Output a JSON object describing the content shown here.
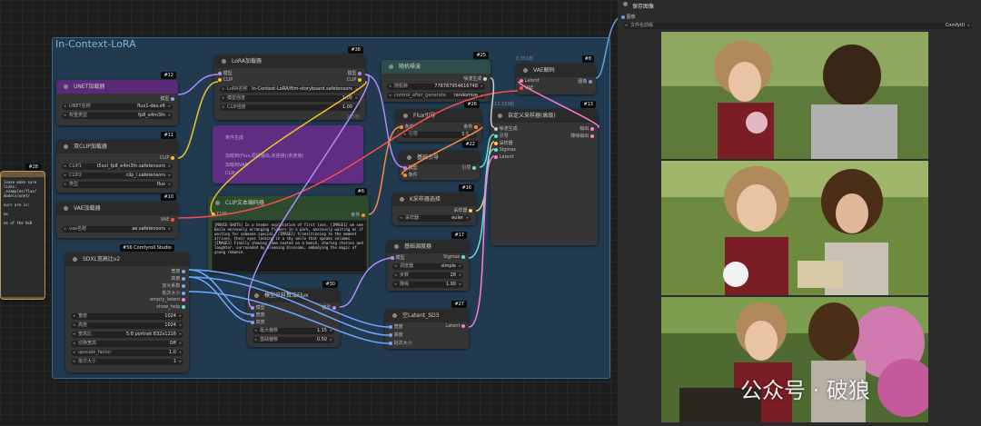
{
  "group": {
    "title": "In-Context-LoRA"
  },
  "nodes": {
    "unet": {
      "title": "UNET加载器",
      "badge": "#12",
      "out": "模型",
      "w1_l": "UNET名称",
      "w1_v": "flux1-dev.sft",
      "w2_l": "权重类型",
      "w2_v": "fp8_e4m3fn"
    },
    "dualclip": {
      "title": "双CLIP加载器",
      "badge": "#11",
      "out": "CLIP",
      "w1_l": "CLIP1",
      "w1_v": "t5xxl_fp8_e4m3fn.safetensors",
      "w2_l": "CLIP2",
      "w2_v": "clip_l.safetensors",
      "w3_l": "类型",
      "w3_v": "flux"
    },
    "vae": {
      "title": "VAE加载器",
      "badge": "#10",
      "out": "VAE",
      "w1_l": "vae名称",
      "w1_v": "ae.safetensors"
    },
    "lora": {
      "title": "LoRA加载器",
      "badge": "#38",
      "in1": "模型",
      "in2": "CLIP",
      "out1": "模型",
      "out2": "CLIP",
      "w1_l": "LoRA名称",
      "w1_v": "In-Context-LoRA/film-storyboard.safetensors",
      "w2_l": "模型强度",
      "w2_v": "1.00",
      "w3_l": "CLIP强度",
      "w3_v": "1.00",
      "footer": "295秒"
    },
    "noise": {
      "title": "随机噪波",
      "badge": "#25",
      "out": "噪波生成",
      "w1_l": "随机种",
      "w1_v": "778787954616748",
      "w2_l": "control_after_generate",
      "w2_v": "randomize",
      "footer": "0.351秒"
    },
    "vaedecode": {
      "title": "VAE解码",
      "badge": "#8",
      "in1": "Latent",
      "in2": "VAE",
      "out": "图像",
      "time": "0.351秒"
    },
    "fluxguide": {
      "title": "Flux引导",
      "badge": "#26",
      "in": "条件",
      "out": "条件",
      "w1_l": "引导",
      "w1_v": "3.5"
    },
    "basicguide": {
      "title": "基础引导",
      "badge": "#22",
      "in1": "模型",
      "in2": "条件",
      "out": "引导"
    },
    "sampler": {
      "title": "自定义采样器(高级)",
      "badge": "#13",
      "in1": "噪波生成",
      "in2": "引导",
      "in3": "采样器",
      "in4": "Sigmas",
      "in5": "Latent",
      "out1": "输出",
      "out2": "降噪输出",
      "time": "12.160秒"
    },
    "ksampler": {
      "title": "K采样器选择",
      "badge": "#16",
      "out": "采样器",
      "w1_l": "采样器",
      "w1_v": "euler"
    },
    "basicsched": {
      "title": "基础调度器",
      "badge": "#17",
      "in": "模型",
      "out": "Sigmas",
      "w1_l": "调度器",
      "w1_v": "simple",
      "w2_l": "步数",
      "w2_v": "28",
      "w3_l": "降噪",
      "w3_v": "1.00"
    },
    "cliptext": {
      "title": "CLIP文本编码器",
      "badge": "#6",
      "in": "CLIP",
      "out": "条件",
      "text": "[MOVIE-SHOTS] In a tender exploration of first love, [IMAGE1] we see Emile nervously arranging flowers in a park, anxiously waiting as if waiting for someone special. [IMAGE2] transitioning to the moment arrives, their eyes locking in a shy smile that speaks volumes. [IMAGE3] Finally showing them seated on a bench, sharing stories and laughter, surrounded by blooming blossoms, embodying the magic of young romance."
    },
    "disabled": {
      "l1": "条件生成",
      "l2": "加载到(Flux,原样输出,未连接)(未连接)",
      "l3": "加载到VAE",
      "l4": "CLIP"
    },
    "sdxl": {
      "title": "SDXL宽高比v2",
      "badge": "#56 ComfyroII Studio",
      "outs": [
        "宽度",
        "高度",
        "放大系数",
        "批次大小",
        "empty_latent",
        "show_help"
      ],
      "w1_l": "宽度",
      "w1_v": "1024",
      "w2_l": "高度",
      "w2_v": "1024",
      "w3_l": "宽高比",
      "w3_v": "5:8 portrait 832x1216",
      "w4_l": "切换宽高",
      "w4_v": "Off",
      "w5_l": "upscale_factor",
      "w5_v": "1.0",
      "w6_l": "批次大小",
      "w6_v": "1"
    },
    "modelsampling": {
      "title": "模型采样算法Flux",
      "badge": "#30",
      "in1": "模型",
      "in2": "宽度",
      "in3": "高度",
      "out": "模型",
      "w1_l": "最大偏移",
      "w1_v": "1.15",
      "w2_l": "基础偏移",
      "w2_v": "0.50"
    },
    "emptylatent": {
      "title": "空Latent_SD3",
      "badge": "#27",
      "in1": "宽度",
      "in2": "高度",
      "in3": "批次大小",
      "out": "Latent"
    },
    "note": {
      "badge": "#28",
      "lines": [
        "lease make sure",
        "",
        "links:",
        "_examples/flux/",
        "models/unet/",
        "",
        "ours are in:",
        "",
        "ae",
        "",
        "ne of the 8x8"
      ]
    }
  },
  "save": {
    "title": "保存图像",
    "in": "图像",
    "w_l": "文件名前缀",
    "w_v": "ComfyUI"
  },
  "watermark": "公众号 · 破狼",
  "colors": {
    "accent": "#3d6a8a",
    "wire_yellow": "#f2c12e",
    "wire_purple": "#b28cff",
    "wire_blue": "#6fa8ff",
    "wire_orange": "#ff8a3d",
    "wire_pink": "#ff7cd3",
    "wire_red": "#ff4d4d",
    "wire_teal": "#63e0e0"
  }
}
